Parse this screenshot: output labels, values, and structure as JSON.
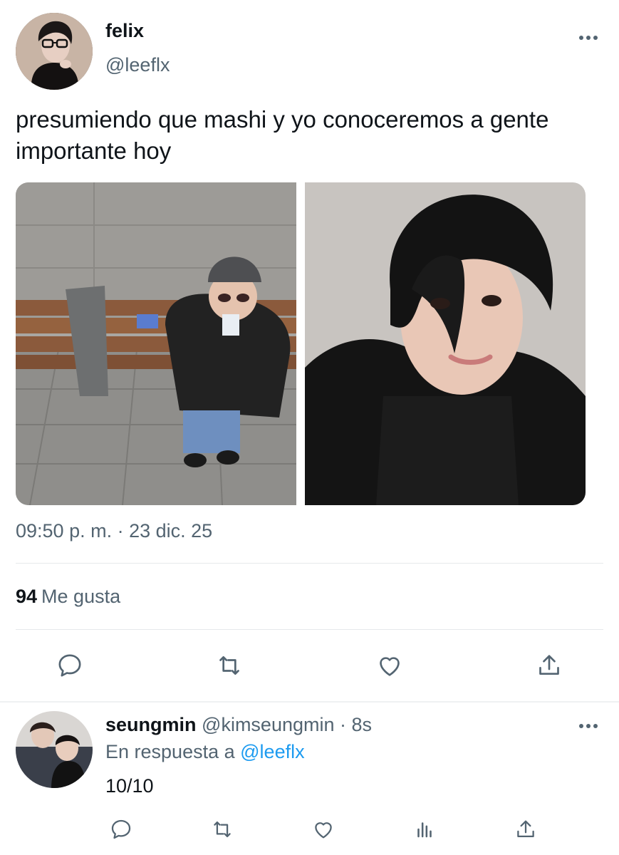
{
  "main_tweet": {
    "author": {
      "display_name": "felix",
      "handle": "@leeflx"
    },
    "text": "presumiendo que mashi y yo conoceremos a gente importante hoy",
    "timestamp": "09:50 p. m. · 23 dic. 25",
    "likes": {
      "count": "94",
      "label": "Me gusta"
    },
    "media": [
      {
        "icon": "photo-child-on-bench"
      },
      {
        "icon": "photo-portrait-selfie"
      }
    ],
    "actions": [
      "reply-icon",
      "retweet-icon",
      "like-icon",
      "share-icon"
    ]
  },
  "reply": {
    "author": {
      "display_name": "seungmin",
      "handle": "@kimseungmin"
    },
    "separator": "·",
    "time": "8s",
    "context_prefix": "En respuesta a",
    "context_handle": "@leeflx",
    "text": "10/10",
    "actions": [
      "reply-icon",
      "retweet-icon",
      "like-icon",
      "analytics-icon",
      "share-icon"
    ]
  },
  "colors": {
    "text_primary": "#0f1419",
    "text_secondary": "#536471",
    "link": "#1d9bf0",
    "divider": "#e6e9eb"
  }
}
